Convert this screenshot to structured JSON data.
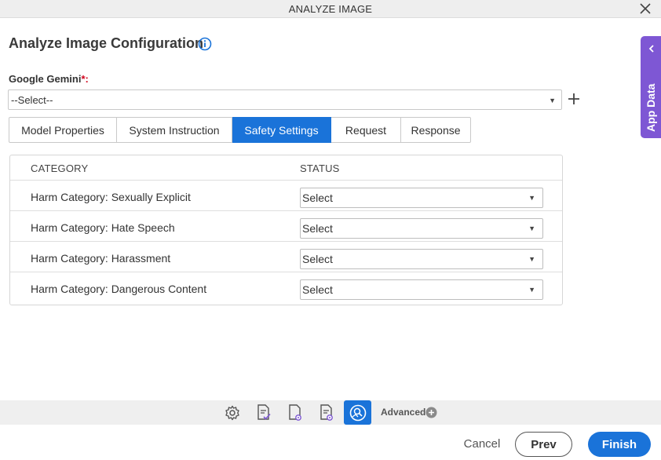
{
  "window": {
    "title": "ANALYZE IMAGE"
  },
  "page": {
    "heading": "Analyze Image Configuration"
  },
  "provider": {
    "label": "Google Gemini",
    "required_mark": "*:",
    "selected": "--Select--"
  },
  "tabs": [
    {
      "label": "Model Properties",
      "active": false
    },
    {
      "label": "System Instruction",
      "active": false
    },
    {
      "label": "Safety Settings",
      "active": true
    },
    {
      "label": "Request",
      "active": false
    },
    {
      "label": "Response",
      "active": false
    }
  ],
  "table": {
    "headers": {
      "category": "CATEGORY",
      "status": "STATUS"
    },
    "rows": [
      {
        "category": "Harm Category: Sexually Explicit",
        "status": "Select"
      },
      {
        "category": "Harm Category: Hate Speech",
        "status": "Select"
      },
      {
        "category": "Harm Category: Harassment",
        "status": "Select"
      },
      {
        "category": "Harm Category: Dangerous Content",
        "status": "Select"
      }
    ]
  },
  "side_panel": {
    "label": "App Data"
  },
  "toolbar": {
    "icons": [
      "settings-gear-icon",
      "document-check-icon",
      "document-settings-icon",
      "document-gear-icon",
      "analyze-image-icon"
    ],
    "advanced_label": "Advanced"
  },
  "footer": {
    "cancel": "Cancel",
    "prev": "Prev",
    "finish": "Finish"
  },
  "colors": {
    "accent": "#1a73d9",
    "side_panel": "#7e57d4",
    "required": "#d0021b"
  }
}
